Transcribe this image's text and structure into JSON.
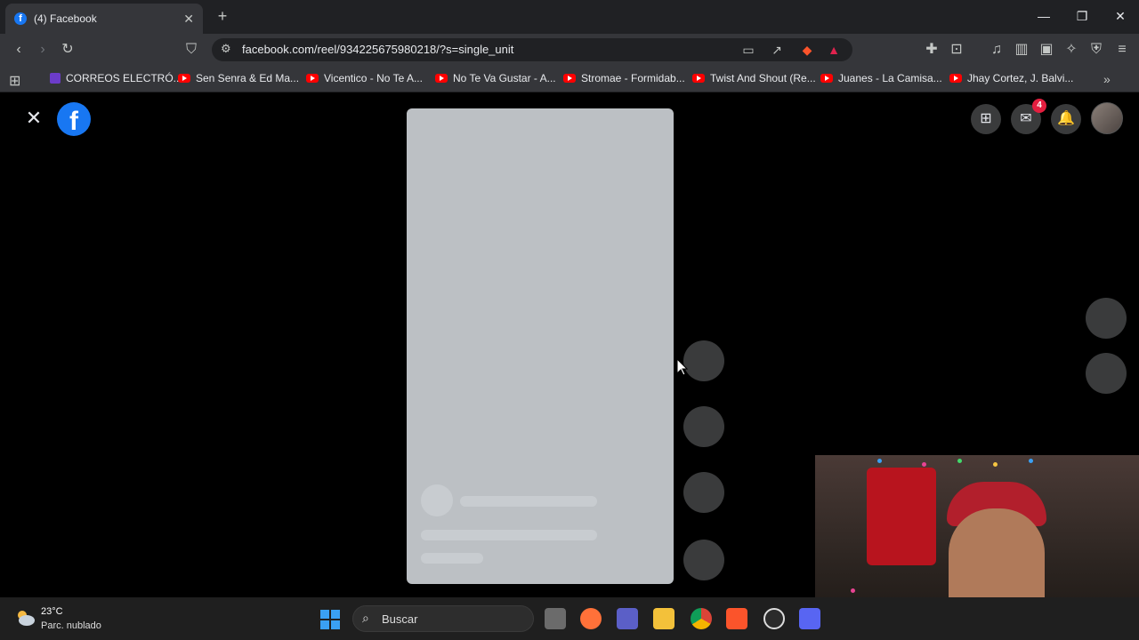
{
  "browser": {
    "tab_title": "(4) Facebook",
    "url": "facebook.com/reel/934225675980218/?s=single_unit"
  },
  "bookmarks": [
    "CORREOS ELECTRÓ...",
    "Sen Senra & Ed Ma...",
    "Vicentico - No Te A...",
    "No Te Va Gustar - A...",
    "Stromae - Formidab...",
    "Twist And Shout (Re...",
    "Juanes - La Camisa...",
    "Jhay Cortez, J. Balvi..."
  ],
  "facebook": {
    "logo_letter": "f",
    "notification_count": "4"
  },
  "taskbar": {
    "temperature": "23°C",
    "weather_desc": "Parc. nublado",
    "search_placeholder": "Buscar"
  },
  "colors": {
    "facebook_blue": "#1877f2",
    "skeleton": "#bcc0c4",
    "badge_red": "#e41e3f"
  }
}
